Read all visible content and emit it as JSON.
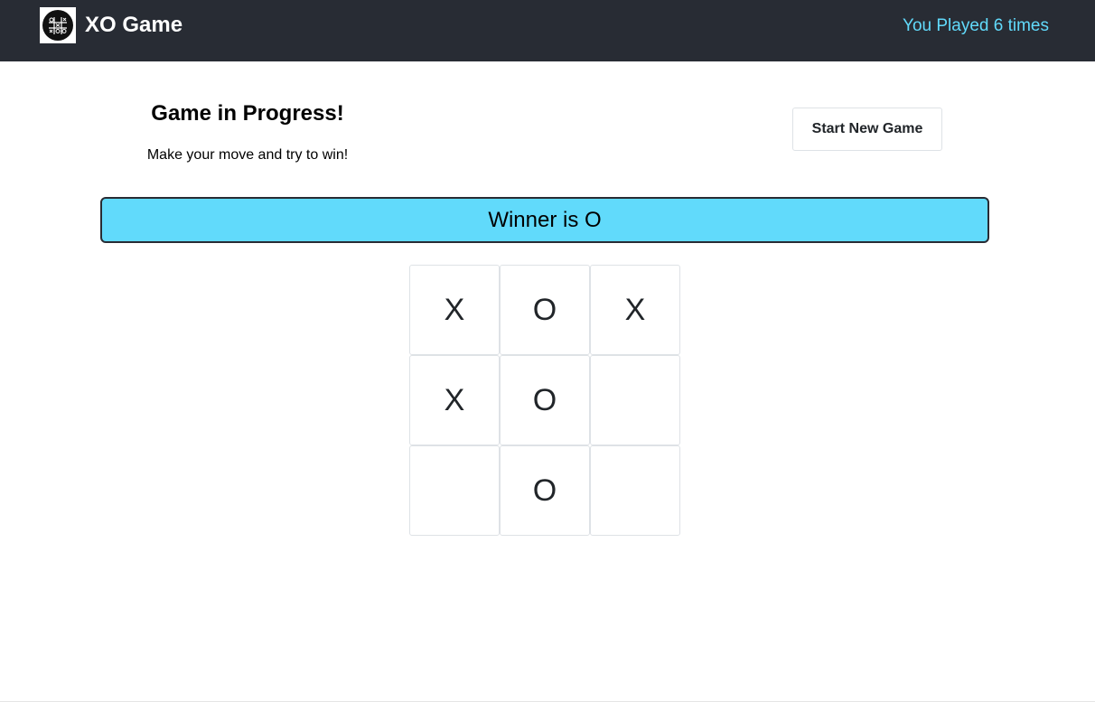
{
  "navbar": {
    "brand_title": "XO Game",
    "logo_icon": "tic-tac-toe-logo-icon",
    "played_count_text": "You Played 6 times",
    "background_color": "#282c34",
    "accent_color": "#61dafb"
  },
  "status": {
    "title": "Game in Progress!",
    "subtitle": "Make your move and try to win!"
  },
  "actions": {
    "new_game_label": "Start New Game"
  },
  "winner_banner": {
    "text": "Winner is O",
    "color": "#61dafb"
  },
  "board": {
    "cells": [
      "X",
      "O",
      "X",
      "X",
      "O",
      "",
      "",
      "O",
      ""
    ]
  }
}
